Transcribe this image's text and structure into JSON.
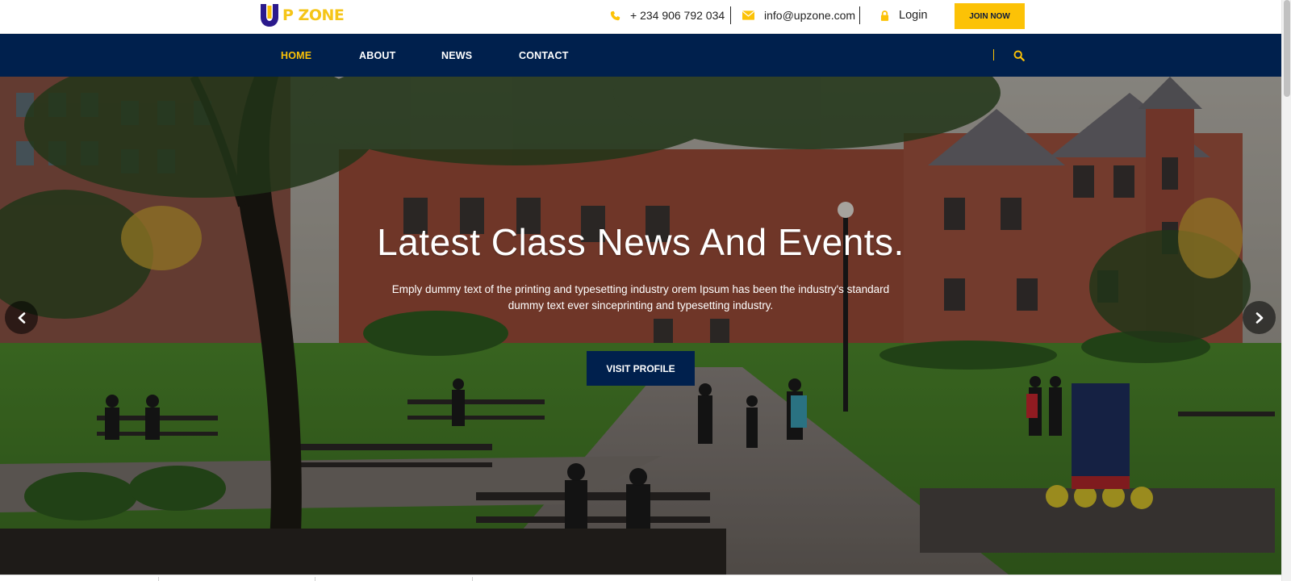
{
  "header": {
    "logo_text": "P ZONE",
    "phone": "+ 234 906 792 034",
    "email": "info@upzone.com",
    "login_label": "Login",
    "join_label": "JOIN NOW"
  },
  "nav": {
    "items": [
      {
        "label": "HOME",
        "active": true
      },
      {
        "label": "ABOUT",
        "active": false
      },
      {
        "label": "NEWS",
        "active": false
      },
      {
        "label": "CONTACT",
        "active": false
      }
    ]
  },
  "hero": {
    "title": "Latest Class News And Events.",
    "description": "Emply dummy text of the printing and typesetting industry orem Ipsum has been the industry's standard dummy text ever sinceprinting and typesetting industry.",
    "button_label": "VISIT PROFILE"
  },
  "colors": {
    "navy": "#00204d",
    "accent_yellow": "#fcc206",
    "logo_purple": "#2b1a8c"
  },
  "icons": {
    "phone": "phone-icon",
    "email": "envelope-icon",
    "login": "lock-icon",
    "search": "search-icon",
    "prev": "chevron-left-icon",
    "next": "chevron-right-icon"
  }
}
